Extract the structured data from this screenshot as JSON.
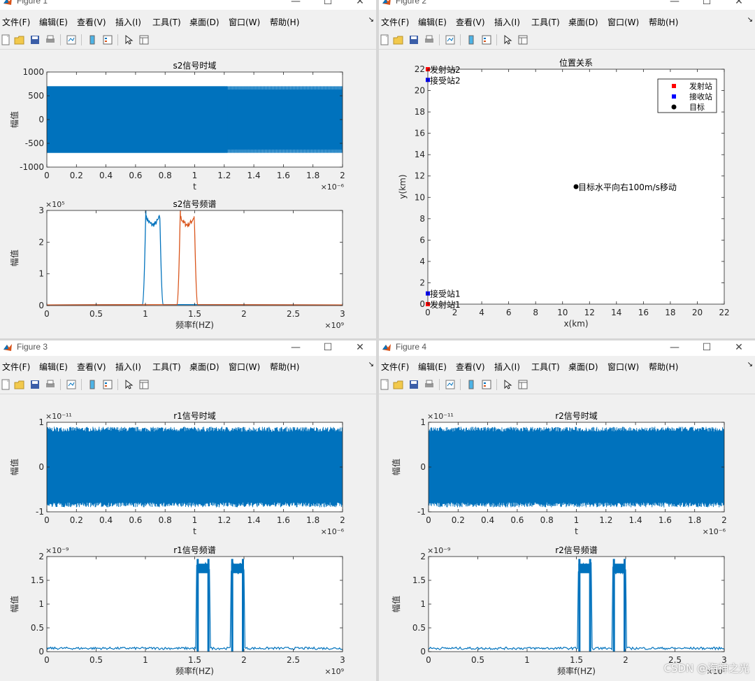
{
  "menu": [
    "文件(F)",
    "编辑(E)",
    "查看(V)",
    "插入(I)",
    "工具(T)",
    "桌面(D)",
    "窗口(W)",
    "帮助(H)"
  ],
  "windows": {
    "fig1": {
      "title": "Figure 1"
    },
    "fig2": {
      "title": "Figure 2"
    },
    "fig3": {
      "title": "Figure 3"
    },
    "fig4": {
      "title": "Figure 4"
    }
  },
  "window_controls": {
    "minimize": "—",
    "maximize": "☐",
    "close": "✕"
  },
  "watermark": "CSDN @海神之光",
  "colors": {
    "blue": "#0072BD",
    "orange": "#D95319",
    "red": "#FF0000",
    "marker_blue": "#0000FF",
    "black": "#000000"
  },
  "chart_data": [
    {
      "id": "s2_time",
      "window": "Figure 1",
      "type": "line",
      "title": "s2信号时域",
      "xlabel": "t",
      "ylabel": "幅值",
      "xlim": [
        0,
        2
      ],
      "ylim": [
        -1000,
        1000
      ],
      "x_exponent": "×10⁻⁶",
      "xticks": [
        "0",
        "0.2",
        "0.4",
        "0.6",
        "0.8",
        "1",
        "1.2",
        "1.4",
        "1.6",
        "1.8",
        "2"
      ],
      "yticks": [
        "-1000",
        "-500",
        "0",
        "500",
        "1000"
      ],
      "series": [
        {
          "color": "#0072BD",
          "amplitude": 700,
          "description_points": {
            "x": [
              0,
              1.2,
              2
            ],
            "y_envelope": [
              700,
              700,
              700
            ]
          }
        }
      ]
    },
    {
      "id": "s2_spec",
      "window": "Figure 1",
      "type": "line",
      "title": "s2信号频谱",
      "xlabel": "频率f(HZ)",
      "ylabel": "幅值",
      "xlim": [
        0,
        3
      ],
      "ylim": [
        0,
        3
      ],
      "x_exponent": "×10⁹",
      "y_exponent": "×10⁵",
      "xticks": [
        "0",
        "0.5",
        "1",
        "1.5",
        "2",
        "2.5",
        "3"
      ],
      "yticks": [
        "0",
        "1",
        "2",
        "3"
      ],
      "series": [
        {
          "color": "#0072BD",
          "band": [
            1.0,
            1.15
          ],
          "level": 2.8
        },
        {
          "color": "#D95319",
          "band": [
            1.35,
            1.5
          ],
          "level": 2.8
        }
      ]
    },
    {
      "id": "position",
      "window": "Figure 2",
      "type": "scatter",
      "title": "位置关系",
      "xlabel": "x(km)",
      "ylabel": "y(km)",
      "xlim": [
        0,
        22
      ],
      "ylim": [
        0,
        22
      ],
      "xticks": [
        "0",
        "2",
        "4",
        "6",
        "8",
        "10",
        "12",
        "14",
        "16",
        "18",
        "20",
        "22"
      ],
      "yticks": [
        "0",
        "2",
        "4",
        "6",
        "8",
        "10",
        "12",
        "14",
        "16",
        "18",
        "20",
        "22"
      ],
      "legend": {
        "placement": "top-right",
        "entries": [
          "发射站",
          "接收站",
          "目标"
        ]
      },
      "points": [
        {
          "x": 0,
          "y": 22,
          "kind": "transmitter",
          "label": "发射站2"
        },
        {
          "x": 0,
          "y": 21,
          "kind": "receiver",
          "label": "接受站2"
        },
        {
          "x": 0,
          "y": 1,
          "kind": "receiver",
          "label": "接受站1"
        },
        {
          "x": 0,
          "y": 0,
          "kind": "transmitter",
          "label": "发射站1"
        },
        {
          "x": 11,
          "y": 11,
          "kind": "target",
          "label": "目标水平向右100m/s移动"
        }
      ]
    },
    {
      "id": "r1_time",
      "window": "Figure 3",
      "type": "line",
      "title": "r1信号时域",
      "xlabel": "t",
      "ylabel": "幅值",
      "xlim": [
        0,
        2
      ],
      "ylim": [
        -1,
        1
      ],
      "x_exponent": "×10⁻⁶",
      "y_exponent": "×10⁻¹¹",
      "xticks": [
        "0",
        "0.2",
        "0.4",
        "0.6",
        "0.8",
        "1",
        "1.2",
        "1.4",
        "1.6",
        "1.8",
        "2"
      ],
      "yticks": [
        "-1",
        "0",
        "1"
      ],
      "series": [
        {
          "color": "#0072BD",
          "amplitude": 0.9
        }
      ]
    },
    {
      "id": "r1_spec",
      "window": "Figure 3",
      "type": "line",
      "title": "r1信号频谱",
      "xlabel": "频率f(HZ)",
      "ylabel": "幅值",
      "xlim": [
        0,
        3
      ],
      "ylim": [
        0,
        2
      ],
      "x_exponent": "×10⁹",
      "y_exponent": "×10⁻⁹",
      "xticks": [
        "0",
        "0.5",
        "1",
        "1.5",
        "2",
        "2.5",
        "3"
      ],
      "yticks": [
        "0",
        "0.5",
        "1",
        "1.5",
        "2"
      ],
      "series": [
        {
          "color": "#0072BD",
          "bands": [
            [
              1.52,
              1.65
            ],
            [
              1.87,
              2.0
            ]
          ],
          "level": 1.75,
          "noise_floor": 0.07
        }
      ]
    },
    {
      "id": "r2_time",
      "window": "Figure 4",
      "type": "line",
      "title": "r2信号时域",
      "xlabel": "t",
      "ylabel": "幅值",
      "xlim": [
        0,
        2
      ],
      "ylim": [
        -1,
        1
      ],
      "x_exponent": "×10⁻⁶",
      "y_exponent": "×10⁻¹¹",
      "xticks": [
        "0",
        "0.2",
        "0.4",
        "0.6",
        "0.8",
        "1",
        "1.2",
        "1.4",
        "1.6",
        "1.8",
        "2"
      ],
      "yticks": [
        "-1",
        "0",
        "1"
      ],
      "series": [
        {
          "color": "#0072BD",
          "amplitude": 0.9
        }
      ]
    },
    {
      "id": "r2_spec",
      "window": "Figure 4",
      "type": "line",
      "title": "r2信号频谱",
      "xlabel": "频率f(HZ)",
      "ylabel": "幅值",
      "xlim": [
        0,
        3
      ],
      "ylim": [
        0,
        2
      ],
      "x_exponent": "×10⁹",
      "y_exponent": "×10⁻⁹",
      "xticks": [
        "0",
        "0.5",
        "1",
        "1.5",
        "2",
        "2.5",
        "3"
      ],
      "yticks": [
        "0",
        "0.5",
        "1",
        "1.5",
        "2"
      ],
      "series": [
        {
          "color": "#0072BD",
          "bands": [
            [
              1.52,
              1.65
            ],
            [
              1.87,
              2.0
            ]
          ],
          "level": 1.75,
          "noise_floor": 0.07
        }
      ]
    }
  ]
}
